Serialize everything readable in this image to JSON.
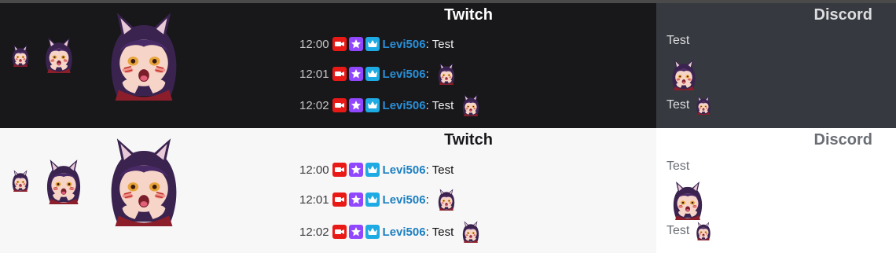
{
  "rows": [
    {
      "theme": "dark",
      "twitch": {
        "title": "Twitch",
        "messages": [
          {
            "time": "12:00",
            "user": "Levi506",
            "colon": ":",
            "text": "Test",
            "emote": false
          },
          {
            "time": "12:01",
            "user": "Levi506",
            "colon": ":",
            "text": "",
            "emote": true
          },
          {
            "time": "12:02",
            "user": "Levi506",
            "colon": ":",
            "text": "Test",
            "emote": true
          }
        ]
      },
      "discord": {
        "title": "Discord",
        "lines": [
          {
            "text": "Test"
          },
          {
            "text": "Test"
          }
        ]
      }
    },
    {
      "theme": "light",
      "twitch": {
        "title": "Twitch",
        "messages": [
          {
            "time": "12:00",
            "user": "Levi506",
            "colon": ":",
            "text": "Test",
            "emote": false
          },
          {
            "time": "12:01",
            "user": "Levi506",
            "colon": ":",
            "text": "",
            "emote": true
          },
          {
            "time": "12:02",
            "user": "Levi506",
            "colon": ":",
            "text": "Test",
            "emote": true
          }
        ]
      },
      "discord": {
        "title": "Discord",
        "lines": [
          {
            "text": "Test"
          },
          {
            "text": "Test"
          }
        ]
      }
    }
  ],
  "badges": [
    "video-badge-icon",
    "star-badge-icon",
    "crown-badge-icon"
  ],
  "colors": {
    "twitch_dark_bg": "#18181b",
    "twitch_light_bg": "#f7f7f8",
    "discord_dark_bg": "#36393f",
    "discord_light_bg": "#ffffff",
    "badge_red": "#e91916",
    "badge_purple": "#9147ff",
    "badge_blue": "#1eaae3",
    "username": "#1e90ff"
  }
}
